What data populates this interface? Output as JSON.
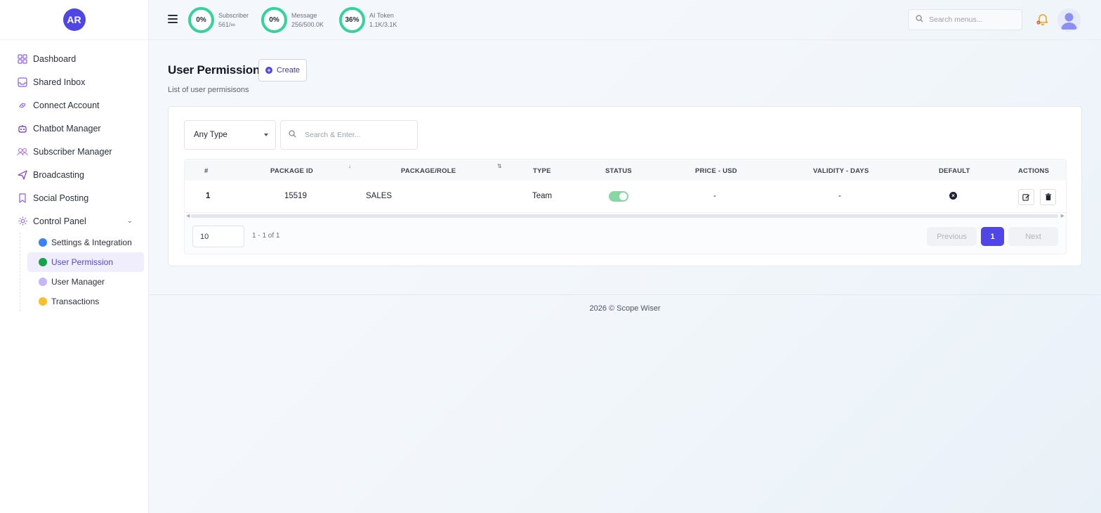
{
  "brand": {
    "initials": "AR"
  },
  "sidebar": {
    "items": [
      {
        "label": "Dashboard",
        "icon": "dashboard-icon"
      },
      {
        "label": "Shared Inbox",
        "icon": "inbox-icon"
      },
      {
        "label": "Connect Account",
        "icon": "link-icon"
      },
      {
        "label": "Chatbot Manager",
        "icon": "robot-icon"
      },
      {
        "label": "Subscriber Manager",
        "icon": "users-icon"
      },
      {
        "label": "Broadcasting",
        "icon": "send-icon"
      },
      {
        "label": "Social Posting",
        "icon": "bookmark-icon"
      },
      {
        "label": "Control Panel",
        "icon": "gear-icon"
      }
    ],
    "subitems": [
      {
        "label": "Settings & Integration",
        "color": "#3b82f6"
      },
      {
        "label": "User Permission",
        "color": "#16a34a"
      },
      {
        "label": "User Manager",
        "color": "#a78bfa"
      },
      {
        "label": "Transactions",
        "color": "#f59e0b"
      }
    ]
  },
  "topbar": {
    "stats": [
      {
        "percent": "0%",
        "label": "Subscriber",
        "value": "561/∞"
      },
      {
        "percent": "0%",
        "label": "Message",
        "value": "256/500.0K"
      },
      {
        "percent": "36%",
        "label": "AI Token",
        "value": "1.1K/3.1K"
      }
    ],
    "search_placeholder": "Search menus..."
  },
  "page": {
    "title": "User Permission",
    "create_label": "Create",
    "subtitle": "List of user permisisons"
  },
  "filters": {
    "type_selected": "Any Type",
    "search_placeholder": "Search & Enter..."
  },
  "table": {
    "headers": [
      "#",
      "PACKAGE ID",
      "PACKAGE/ROLE",
      "TYPE",
      "STATUS",
      "PRICE - USD",
      "VALIDITY - DAYS",
      "DEFAULT",
      "ACTIONS"
    ],
    "rows": [
      {
        "index": "1",
        "package_id": "15519",
        "role": "SALES",
        "type": "Team",
        "status": true,
        "price": "-",
        "validity": "-",
        "default": false
      }
    ]
  },
  "pagination": {
    "per_page": "10",
    "range": "1 - 1 of 1",
    "previous": "Previous",
    "current": "1",
    "next": "Next"
  },
  "footer": {
    "text": "2026 © Scope Wiser"
  }
}
